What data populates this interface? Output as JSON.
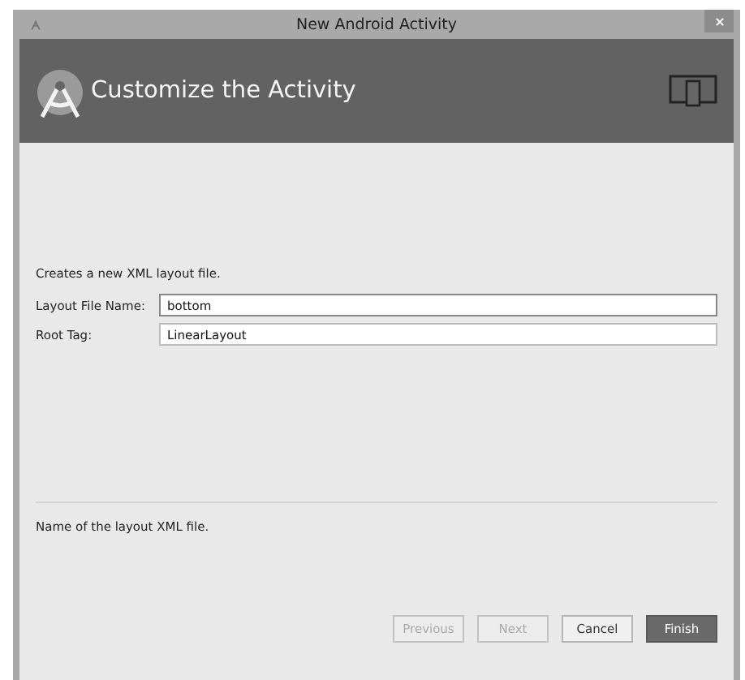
{
  "window": {
    "title": "New Android Activity"
  },
  "header": {
    "title": "Customize the Activity"
  },
  "description": "Creates a new XML layout file.",
  "fields": [
    {
      "label": "Layout File Name:",
      "value": "bottom",
      "focused": true
    },
    {
      "label": "Root Tag:",
      "value": "LinearLayout",
      "focused": false
    }
  ],
  "help_text": "Name of the layout XML file.",
  "buttons": [
    {
      "label": "Previous",
      "disabled": true,
      "default": false
    },
    {
      "label": "Next",
      "disabled": true,
      "default": false
    },
    {
      "label": "Cancel",
      "disabled": false,
      "default": false
    },
    {
      "label": "Finish",
      "disabled": false,
      "default": true
    }
  ]
}
